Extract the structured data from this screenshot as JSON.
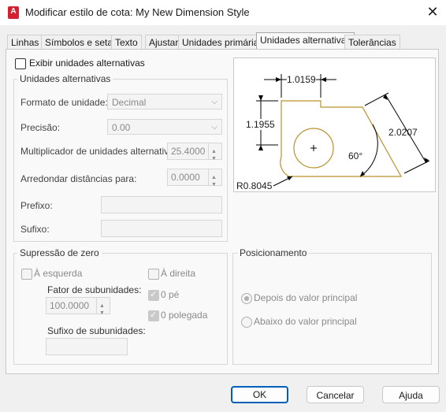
{
  "window": {
    "title": "Modificar estilo de cota: My New Dimension Style",
    "app_icon_letter": "A"
  },
  "tabs": [
    {
      "label": "Linhas"
    },
    {
      "label": "Símbolos e setas"
    },
    {
      "label": "Texto"
    },
    {
      "label": "Ajustar"
    },
    {
      "label": "Unidades primárias"
    },
    {
      "label": "Unidades alternativas",
      "active": true
    },
    {
      "label": "Tolerâncias"
    }
  ],
  "alt_units": {
    "enable_label": "Exibir unidades alternativas",
    "enable_checked": false,
    "group_title": "Unidades alternativas",
    "unit_format_label": "Formato de unidade:",
    "unit_format_value": "Decimal",
    "precision_label": "Precisão:",
    "precision_value": "0.00",
    "multiplier_label": "Multiplicador de unidades alternativas:",
    "multiplier_value": "25.4000",
    "round_label": "Arredondar distâncias para:",
    "round_value": "0.0000",
    "prefix_label": "Prefixo:",
    "prefix_value": "",
    "suffix_label": "Sufixo:",
    "suffix_value": ""
  },
  "zero_suppression": {
    "group_title": "Supressão de zero",
    "leading_label": "À esquerda",
    "leading_checked": false,
    "trailing_label": "À direita",
    "trailing_checked": false,
    "subunit_factor_label": "Fator de subunidades:",
    "subunit_factor_value": "100.0000",
    "subunit_suffix_label": "Sufixo de subunidades:",
    "subunit_suffix_value": "",
    "feet_label": "0 pé",
    "feet_checked": true,
    "inches_label": "0 polegada",
    "inches_checked": true
  },
  "placement": {
    "group_title": "Posicionamento",
    "after_label": "Depois do valor principal",
    "after_selected": true,
    "below_label": "Abaixo do valor principal",
    "below_selected": false
  },
  "preview": {
    "dim_top": "1.0159",
    "dim_left": "1.1955",
    "dim_right": "2.0207",
    "dim_angle": "60°",
    "dim_radius": "R0.8045",
    "outline_color": "#b8922c"
  },
  "buttons": {
    "ok": "OK",
    "cancel": "Cancelar",
    "help": "Ajuda"
  }
}
